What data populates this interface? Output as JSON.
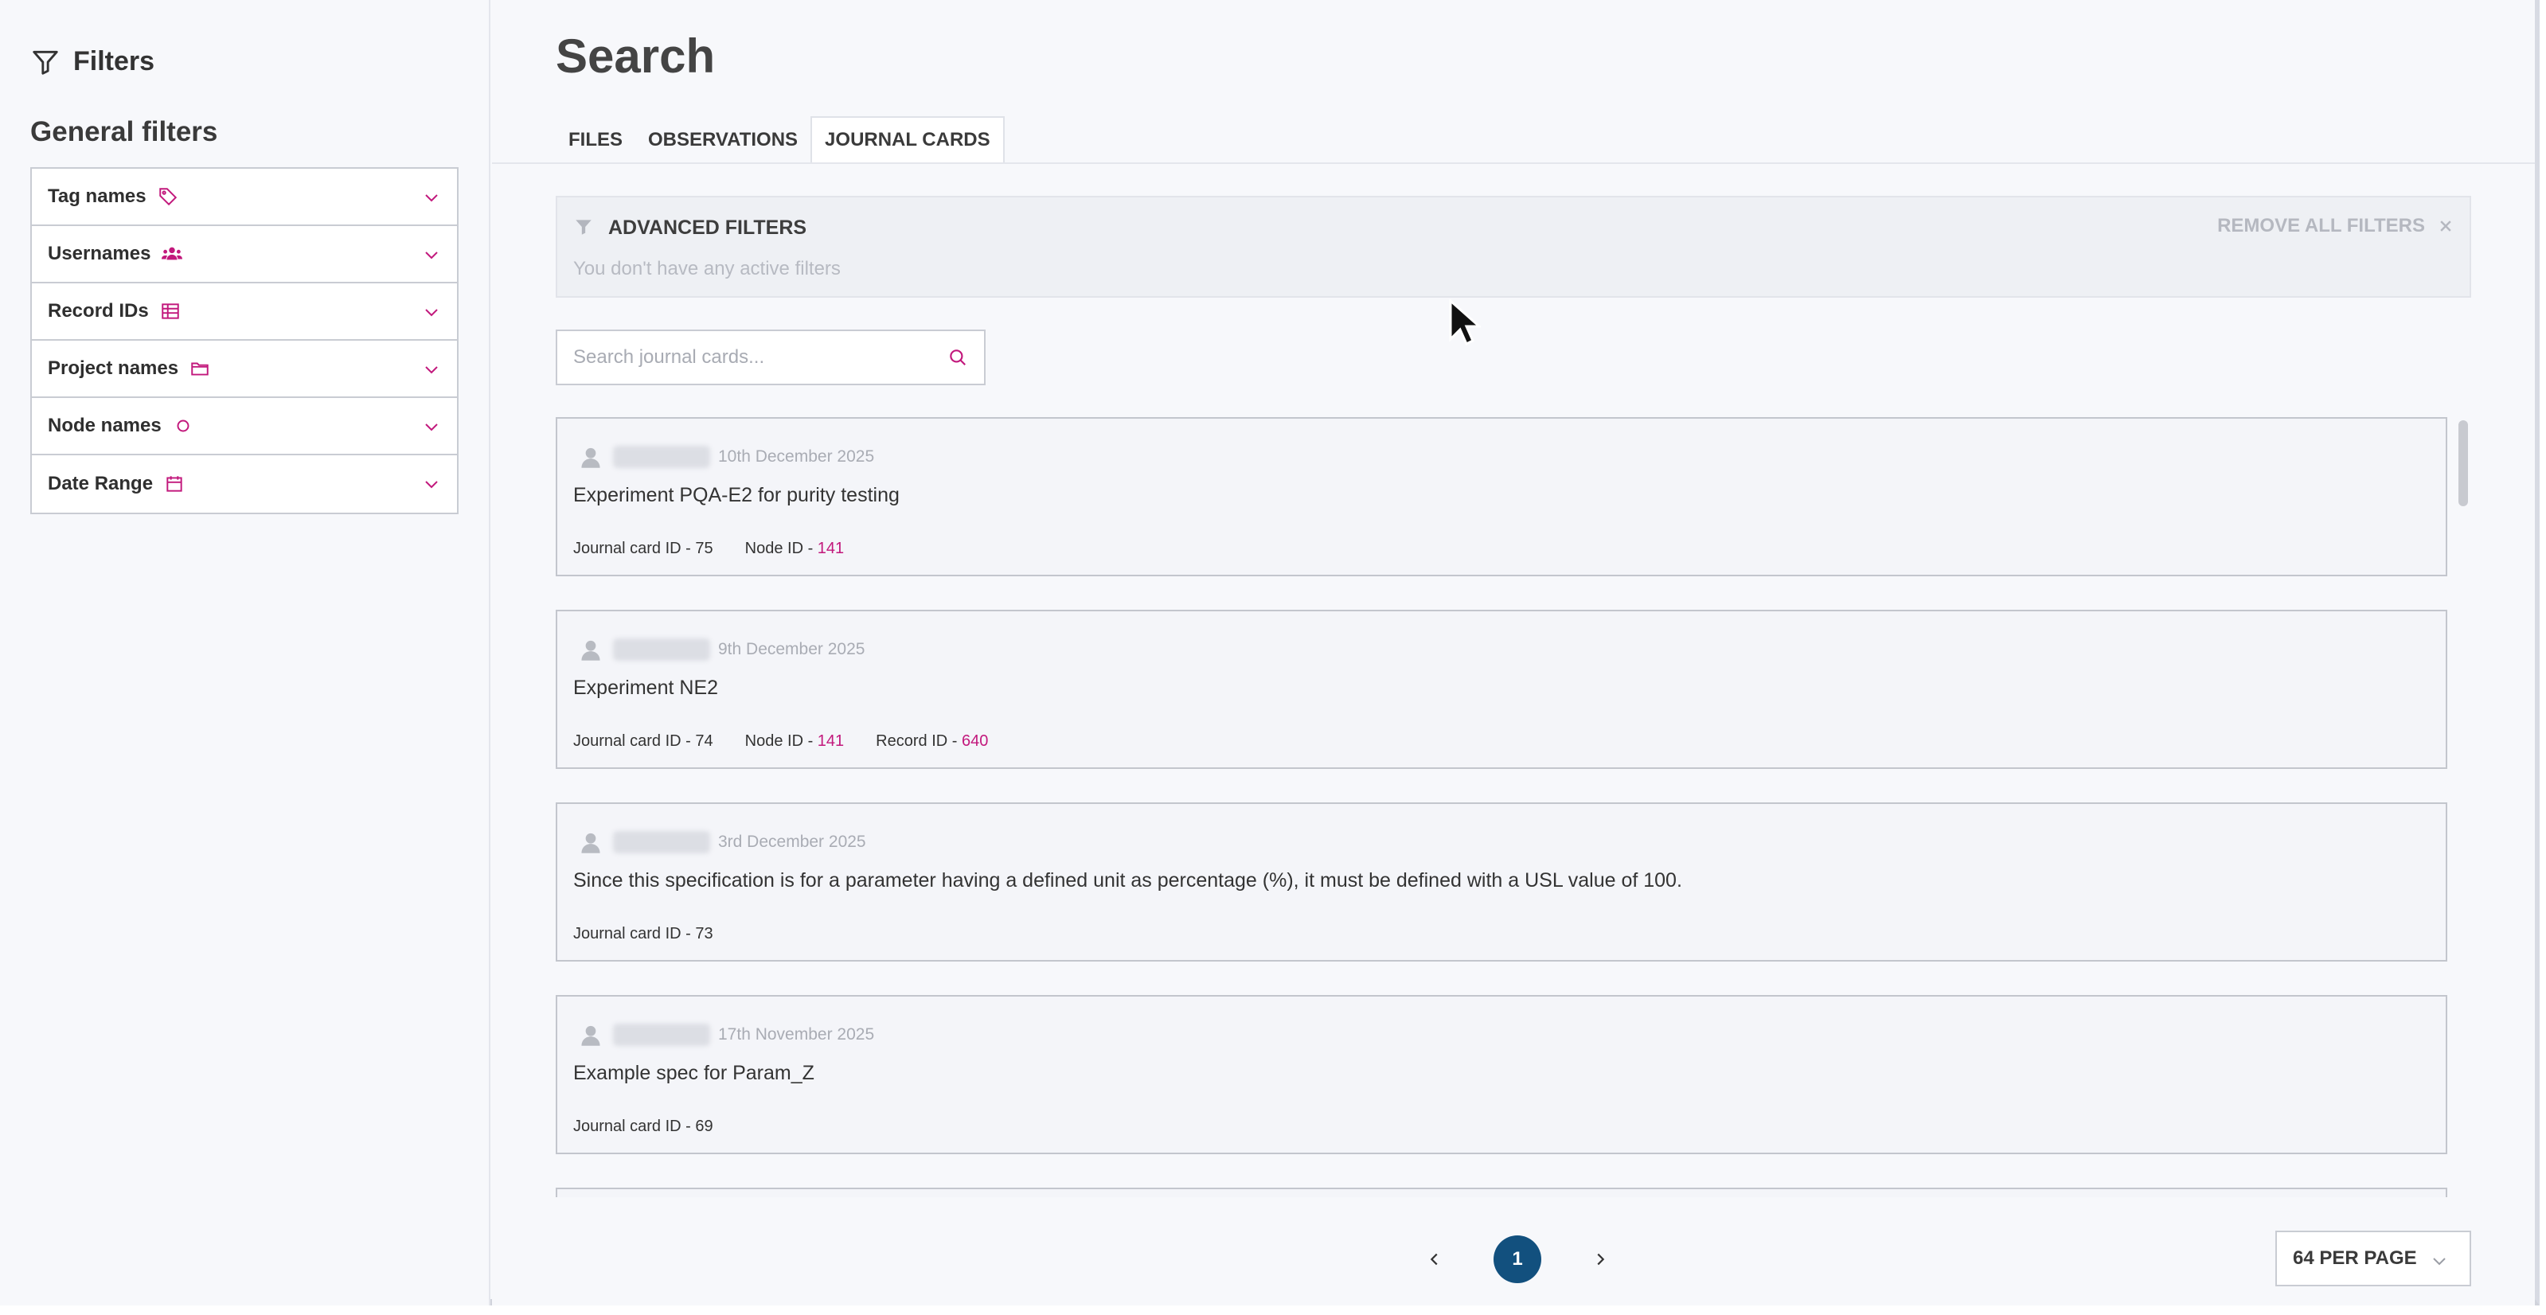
{
  "sidebar": {
    "title": "Filters",
    "section_title": "General filters",
    "facets": [
      {
        "label": "Tag names",
        "icon": "tag-icon"
      },
      {
        "label": "Usernames",
        "icon": "users-icon"
      },
      {
        "label": "Record IDs",
        "icon": "table-icon"
      },
      {
        "label": "Project names",
        "icon": "folder-icon"
      },
      {
        "label": "Node names",
        "icon": "circle-icon"
      },
      {
        "label": "Date Range",
        "icon": "calendar-icon"
      }
    ]
  },
  "page": {
    "title": "Search",
    "tabs": [
      "FILES",
      "OBSERVATIONS",
      "JOURNAL CARDS"
    ],
    "active_tab": "JOURNAL CARDS"
  },
  "advanced_filters": {
    "title": "ADVANCED FILTERS",
    "empty_text": "You don't have any active filters",
    "remove_all_label": "REMOVE ALL FILTERS"
  },
  "search": {
    "placeholder": "Search journal cards...",
    "value": ""
  },
  "cards": [
    {
      "date": "10th December 2025",
      "title": "Experiment PQA-E2 for purity testing",
      "journal_card_label": "Journal card ID - 75",
      "node_label": "Node ID - ",
      "node_id": "141",
      "record_label": "",
      "record_id": ""
    },
    {
      "date": "9th December 2025",
      "title": "Experiment NE2",
      "journal_card_label": "Journal card ID - 74",
      "node_label": "Node ID - ",
      "node_id": "141",
      "record_label": "Record ID - ",
      "record_id": "640"
    },
    {
      "date": "3rd December 2025",
      "title": "Since this specification is for a parameter having a defined unit as percentage (%), it must be defined with a USL value of 100.",
      "journal_card_label": "Journal card ID - 73",
      "node_label": "",
      "node_id": "",
      "record_label": "",
      "record_id": ""
    },
    {
      "date": "17th November 2025",
      "title": "Example spec for Param_Z",
      "journal_card_label": "Journal card ID - 69",
      "node_label": "",
      "node_id": "",
      "record_label": "",
      "record_id": ""
    }
  ],
  "pagination": {
    "current_page": "1",
    "per_page_label": "64 PER PAGE"
  },
  "colors": {
    "accent_pink": "#c2187c",
    "page_button": "#12507e"
  }
}
